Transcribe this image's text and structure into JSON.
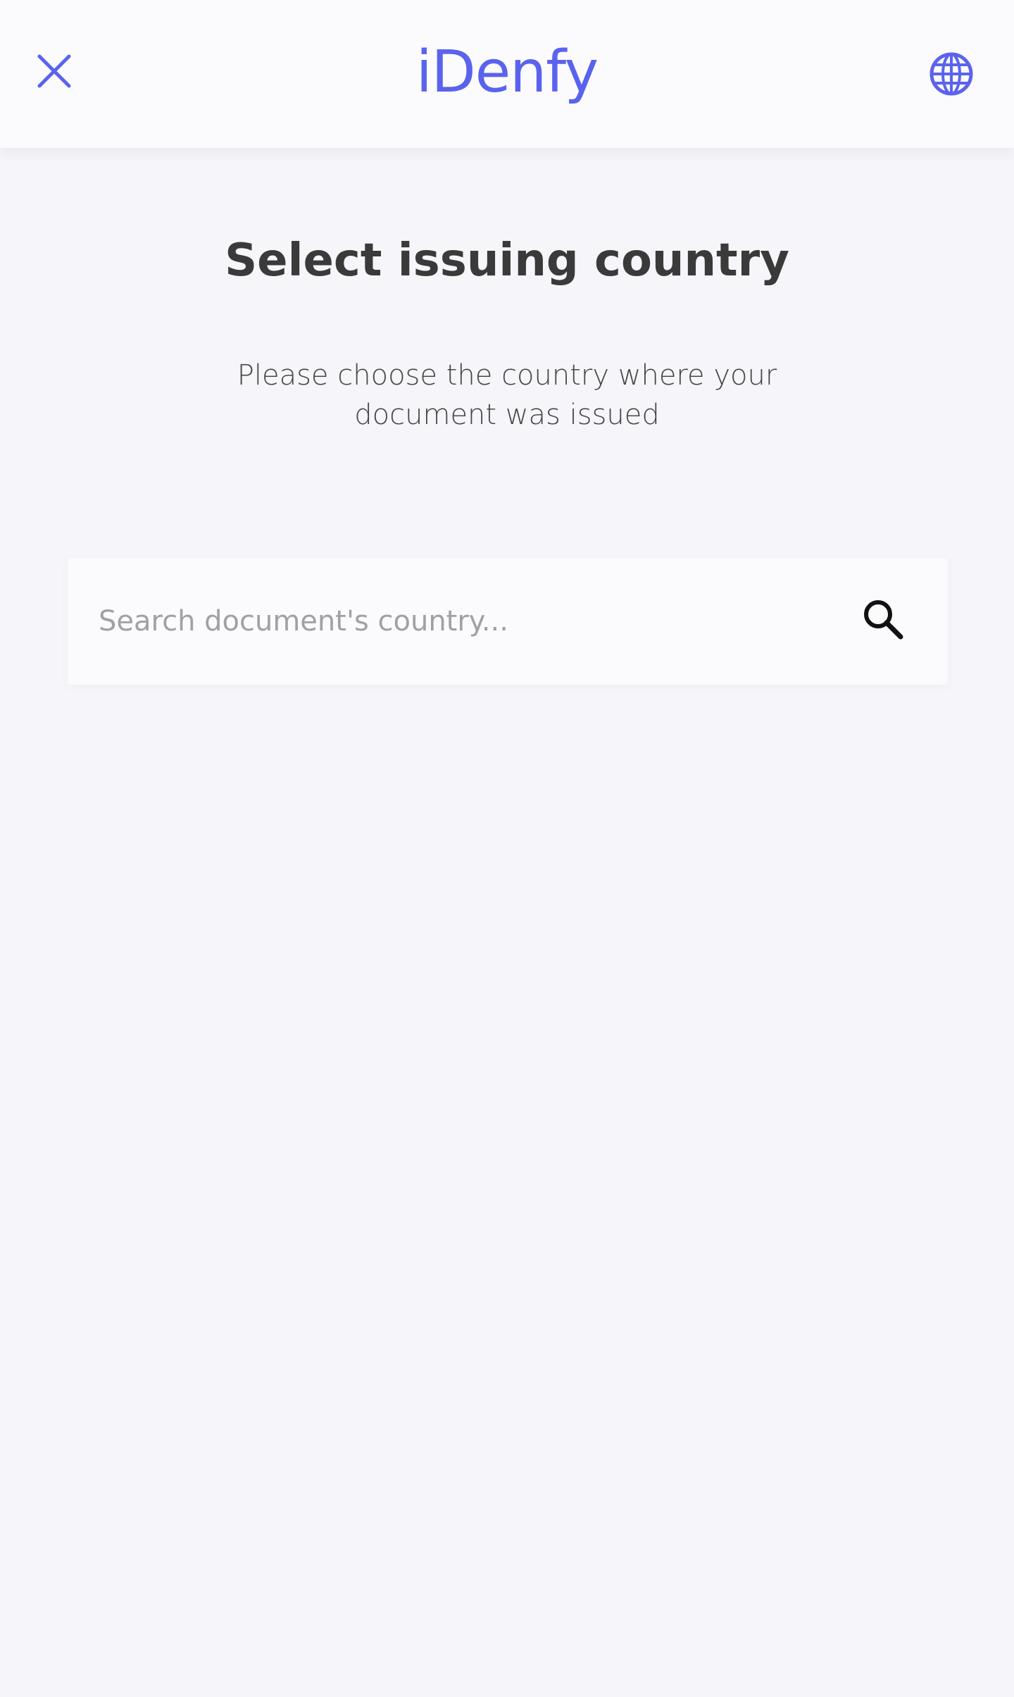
{
  "header": {
    "close_icon": "close-icon",
    "logo_text": "iDenfy",
    "language_icon": "globe-icon"
  },
  "main": {
    "title": "Select issuing country",
    "subtitle": "Please choose the country where your document was issued"
  },
  "search": {
    "placeholder": "Search document's country...",
    "value": "",
    "icon": "search-icon"
  },
  "colors": {
    "brand": "#5a63ee",
    "background": "#f6f6fa",
    "title": "#3a3a3a"
  }
}
